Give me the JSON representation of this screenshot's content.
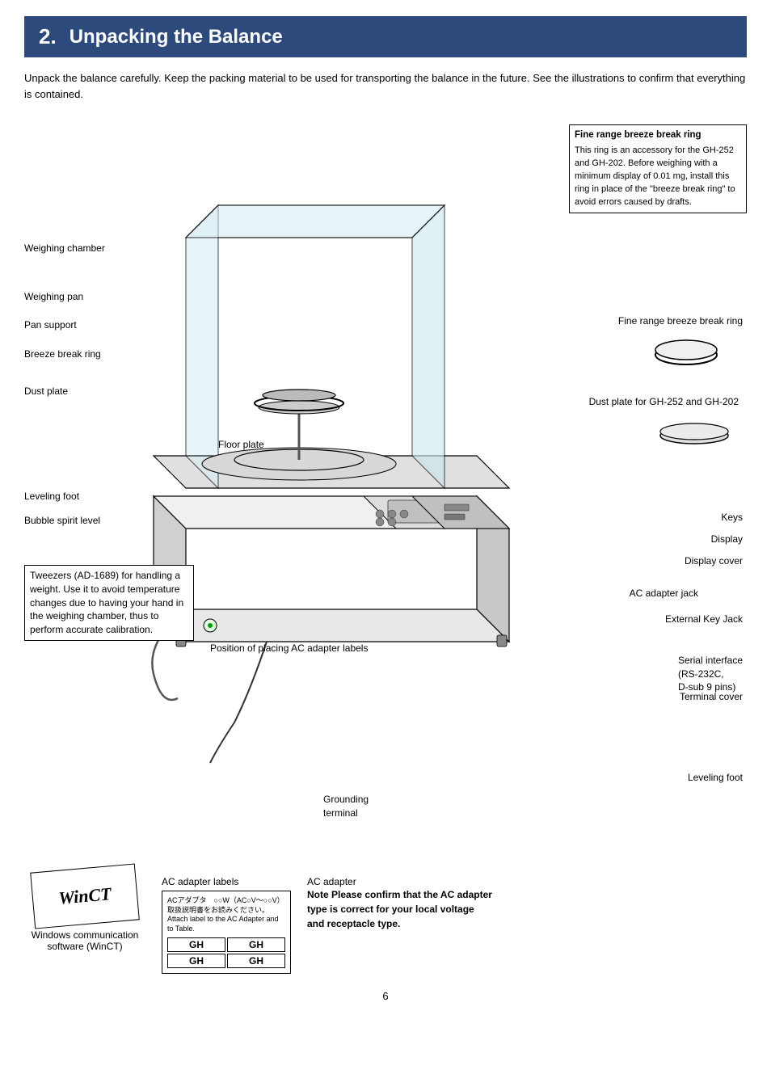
{
  "header": {
    "section_num": "2.",
    "section_title": "Unpacking the Balance"
  },
  "intro": "Unpack the balance carefully. Keep the packing material to be used for transporting the balance in the future. See the illustrations to confirm that everything is contained.",
  "labels": {
    "fine_range_box_title": "Fine range breeze break ring",
    "fine_range_box_body": "This ring is an accessory for the GH-252 and GH-202. Before weighing with a minimum display of 0.01 mg, install this ring in place of the \"breeze break ring\" to avoid errors caused by drafts.",
    "fine_range_label": "Fine range breeze break ring",
    "weighing_chamber": "Weighing chamber",
    "weighing_pan": "Weighing pan",
    "pan_support": "Pan support",
    "breeze_break_ring": "Breeze break ring",
    "dust_plate": "Dust plate",
    "floor_plate": "Floor plate",
    "leveling_foot_left": "Leveling foot",
    "bubble_spirit_level": "Bubble spirit level",
    "keys": "Keys",
    "display": "Display",
    "display_cover": "Display cover",
    "ac_adapter_jack": "AC adapter jack",
    "external_key_jack": "External Key Jack",
    "serial_interface": "Serial interface\n(RS-232C,\nD-sub 9 pins)",
    "terminal_cover": "Terminal cover",
    "leveling_foot_right": "Leveling foot",
    "grounding_terminal": "Grounding\nterminal",
    "dust_plate_gh": "Dust plate for\nGH-252 and GH-202",
    "tweezers_box": "Tweezers (AD-1689) for handling a\nweight. Use it to avoid temperature\nchanges due to having your hand in\nthe weighing chamber, thus to\nperform accurate calibration.",
    "position_placing": "Position of placing\nAC adapter labels",
    "windows_comm": "Windows communication\nsoftware (WinCT)",
    "winct_text": "WinCT",
    "ac_adapter_labels_text": "AC adapter labels",
    "ac_adapter_note_title": "AC adapter",
    "ac_adapter_note_bold": "Note Please confirm that the AC adapter\ntype is correct for your local voltage\nand receptacle type.",
    "gh_cells": [
      "GH",
      "GH",
      "GH",
      "GH"
    ],
    "page_number": "6"
  }
}
